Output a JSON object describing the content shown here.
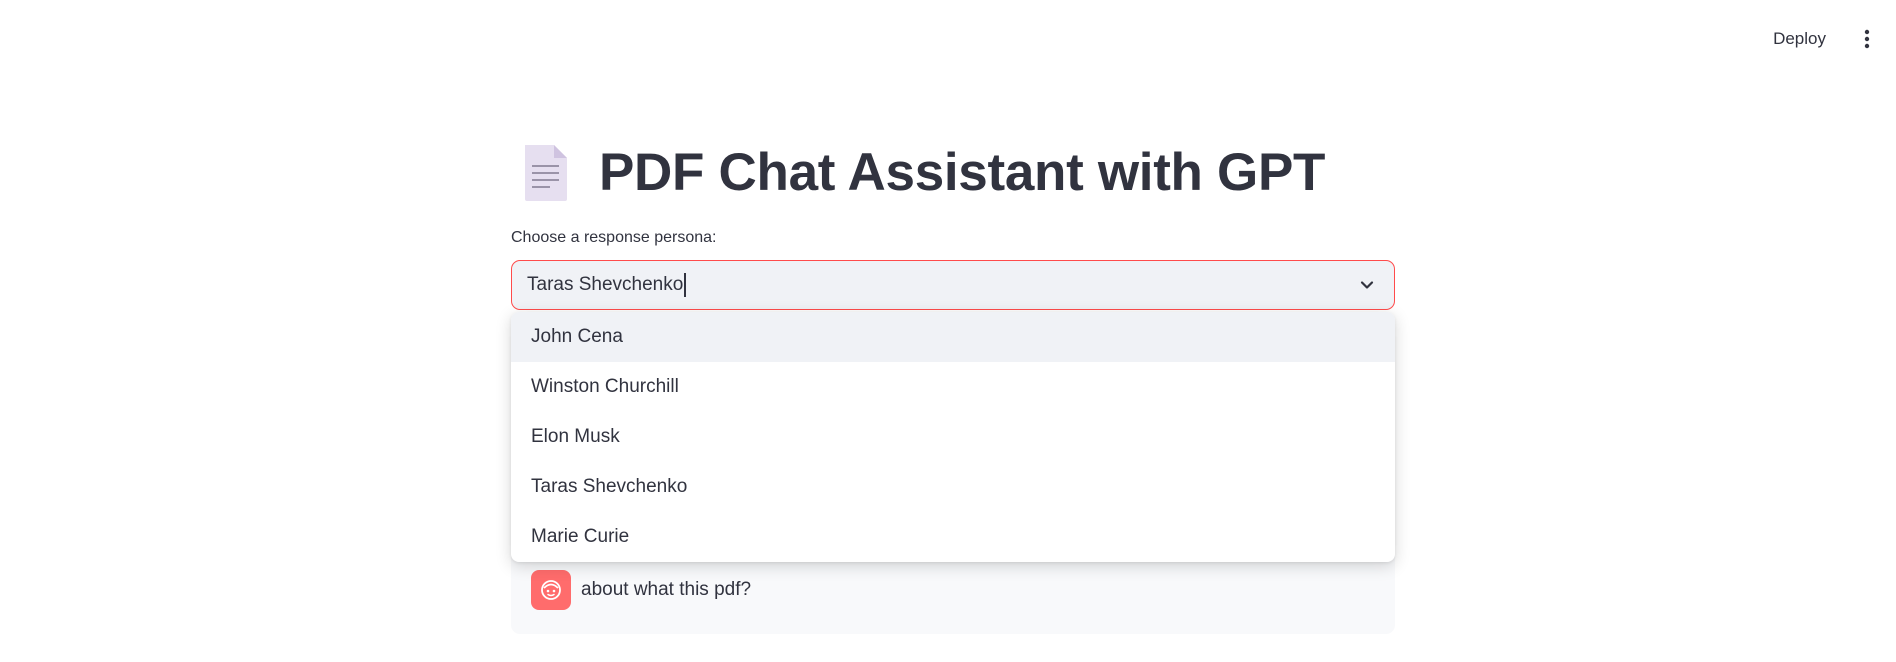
{
  "toolbar": {
    "deploy_label": "Deploy",
    "menu_icon": "vertical-ellipsis-icon"
  },
  "header": {
    "icon": "document-icon",
    "title": "PDF Chat Assistant with GPT"
  },
  "persona_select": {
    "label": "Choose a response persona:",
    "value": "Taras Shevchenko",
    "options": [
      {
        "label": "John Cena"
      },
      {
        "label": "Winston Churchill"
      },
      {
        "label": "Elon Musk"
      },
      {
        "label": "Taras Shevchenko"
      },
      {
        "label": "Marie Curie"
      }
    ],
    "highlighted_index": 0
  },
  "chat": {
    "messages": [
      {
        "role": "user",
        "avatar_icon": "user-avatar-icon",
        "text": "about what this pdf?"
      }
    ]
  },
  "colors": {
    "accent": "#ff4b4b",
    "avatar_bg": "#ff6c6c",
    "input_bg": "#f0f2f6",
    "text": "#31333f"
  }
}
